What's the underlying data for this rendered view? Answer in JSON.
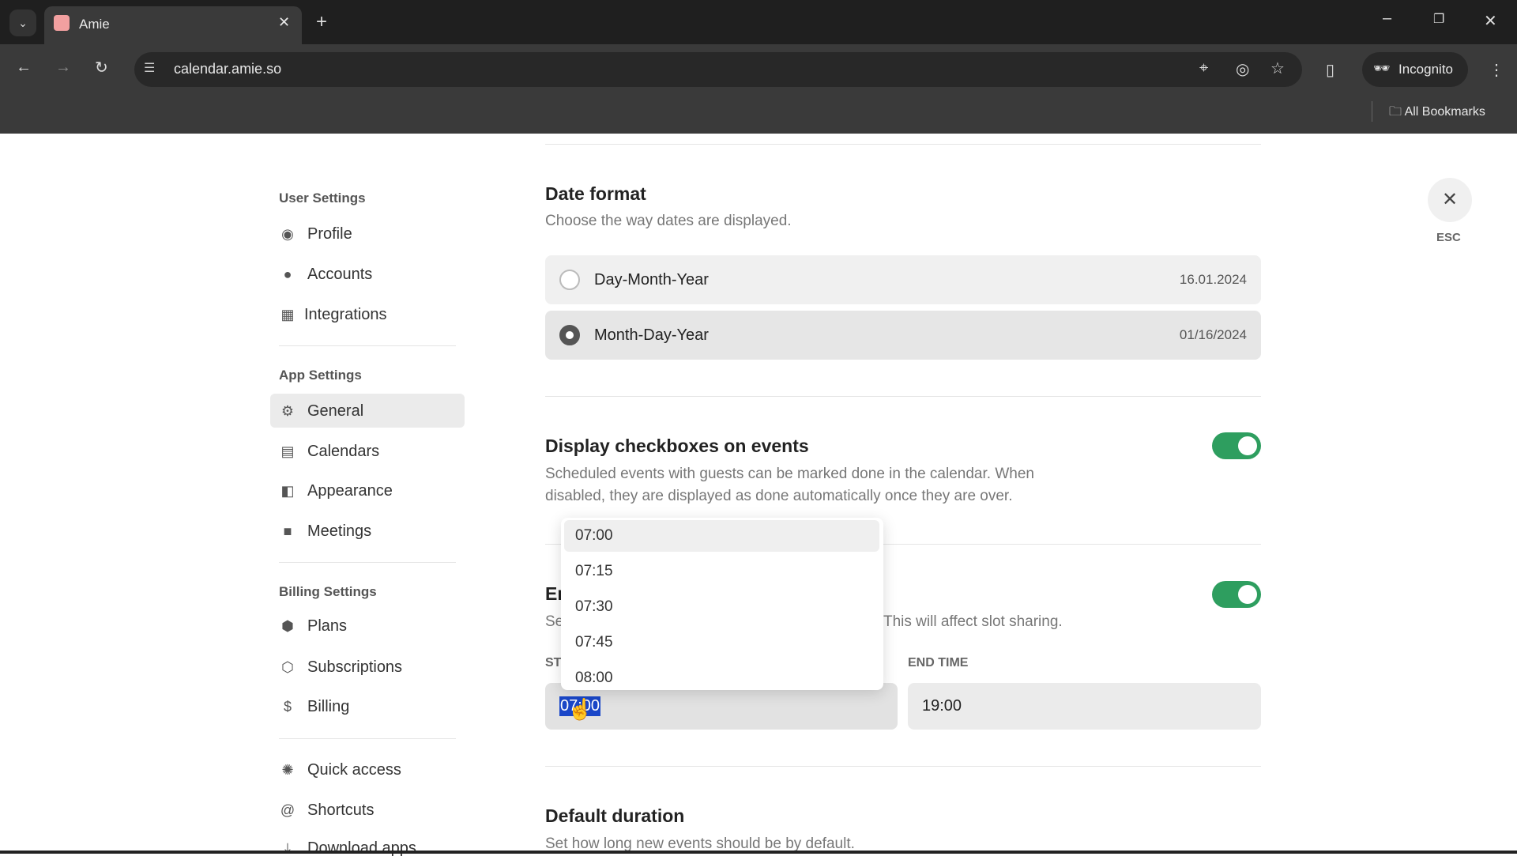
{
  "browser": {
    "tab_title": "Amie",
    "url": "calendar.amie.so",
    "incognito_label": "Incognito",
    "bookmarks_label": "All Bookmarks"
  },
  "sidebar": {
    "user_heading": "User Settings",
    "user_items": [
      {
        "label": "Profile",
        "icon": "user-circle-icon"
      },
      {
        "label": "Accounts",
        "icon": "accounts-icon"
      },
      {
        "label": "Integrations",
        "icon": "grid-icon"
      }
    ],
    "app_heading": "App Settings",
    "app_items": [
      {
        "label": "General",
        "icon": "gear-icon",
        "active": true
      },
      {
        "label": "Calendars",
        "icon": "calendar-icon"
      },
      {
        "label": "Appearance",
        "icon": "appearance-icon"
      },
      {
        "label": "Meetings",
        "icon": "video-icon"
      }
    ],
    "billing_heading": "Billing Settings",
    "billing_items": [
      {
        "label": "Plans",
        "icon": "plans-icon"
      },
      {
        "label": "Subscriptions",
        "icon": "box-icon"
      },
      {
        "label": "Billing",
        "icon": "dollar-icon"
      }
    ],
    "other_items": [
      {
        "label": "Quick access",
        "icon": "quick-access-icon"
      },
      {
        "label": "Shortcuts",
        "icon": "at-icon"
      },
      {
        "label": "Download apps",
        "icon": "download-icon"
      }
    ]
  },
  "main": {
    "date_format": {
      "title": "Date format",
      "description": "Choose the way dates are displayed.",
      "options": [
        {
          "label": "Day-Month-Year",
          "example": "16.01.2024",
          "selected": false
        },
        {
          "label": "Month-Day-Year",
          "example": "01/16/2024",
          "selected": true
        }
      ]
    },
    "checkboxes": {
      "title": "Display checkboxes on events",
      "description_1": "Scheduled events with guests can be marked done in the calendar. When",
      "description_2": "disabled, they are displayed as done automatically once they are over.",
      "enabled": true
    },
    "hours": {
      "title_fragment": "Er",
      "description_fragment": "Se",
      "description_tail": "This will affect slot sharing.",
      "enabled": true,
      "start_label_fragment": "ST",
      "end_label": "END TIME",
      "start_value": "07:00",
      "end_value": "19:00"
    },
    "dropdown_options": [
      "07:00",
      "07:15",
      "07:30",
      "07:45",
      "08:00"
    ],
    "default_duration": {
      "title": "Default duration",
      "description": "Set how long new events should be by default."
    }
  },
  "close": {
    "label": "ESC"
  },
  "colors": {
    "toggle_on": "#2e9e5f",
    "selection": "#1a47c8"
  }
}
